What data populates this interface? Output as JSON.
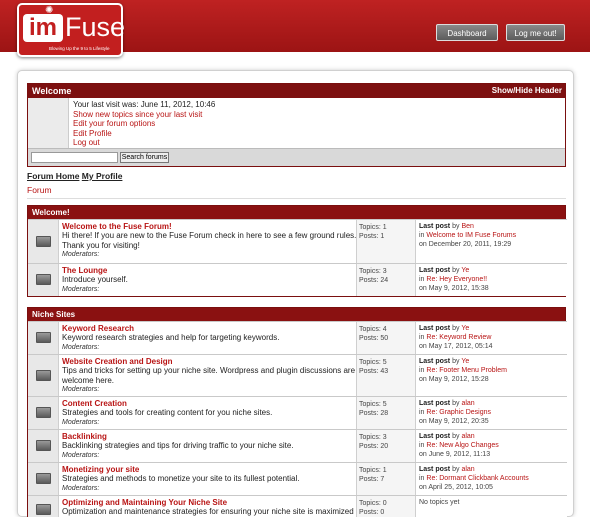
{
  "header": {
    "logo_im": "im",
    "logo_fuse": "Fuse",
    "logo_tagline": "Blowing Up the 9 to 5 Lifestyle",
    "dashboard_label": "Dashboard",
    "logout_label": "Log me out!"
  },
  "welcome": {
    "title": "Welcome",
    "toggle_label": "Show/Hide Header",
    "last_visit": "Your last visit was: June 11, 2012, 10:46",
    "links": [
      "Show new topics since your last visit",
      "Edit your forum options",
      "Edit Profile",
      "Log out"
    ],
    "search_button": "Search forums",
    "search_value": ""
  },
  "nav": {
    "tabs": [
      "Forum Home",
      "My Profile"
    ],
    "breadcrumb": "Forum"
  },
  "categories": [
    {
      "name": "Welcome!",
      "forums": [
        {
          "title": "Welcome to the Fuse Forum!",
          "desc": "Hi there! If you are new to the Fuse Forum check in here to see a few ground rules. Thank you for visiting!",
          "mods": "Moderators:",
          "topics": "Topics: 1",
          "posts": "Posts: 1",
          "last_label": "Last post",
          "by": "by",
          "user": "Ben",
          "in": "in",
          "thread": "Welcome to IM Fuse Forums",
          "date": "on December 20, 2011, 19:29"
        },
        {
          "title": "The Lounge",
          "desc": "Introduce yourself.",
          "mods": "Moderators:",
          "topics": "Topics: 3",
          "posts": "Posts: 24",
          "last_label": "Last post",
          "by": "by",
          "user": "Ye",
          "in": "in",
          "thread": "Re: Hey Everyone!!",
          "date": "on May 9, 2012, 15:38"
        }
      ]
    },
    {
      "name": "Niche Sites",
      "forums": [
        {
          "title": "Keyword Research",
          "desc": "Keyword research strategies and help for targeting keywords.",
          "mods": "Moderators:",
          "topics": "Topics: 4",
          "posts": "Posts: 50",
          "last_label": "Last post",
          "by": "by",
          "user": "Ye",
          "in": "in",
          "thread": "Re: Keyword Review",
          "date": "on May 17, 2012, 05:14"
        },
        {
          "title": "Website Creation and Design",
          "desc": "Tips and tricks for setting up your niche site. Wordpress and plugin discussions are welcome here.",
          "mods": "Moderators:",
          "topics": "Topics: 5",
          "posts": "Posts: 43",
          "last_label": "Last post",
          "by": "by",
          "user": "Ye",
          "in": "in",
          "thread": "Re: Footer Menu Problem",
          "date": "on May 9, 2012, 15:28"
        },
        {
          "title": "Content Creation",
          "desc": "Strategies and tools for creating content for you niche sites.",
          "mods": "Moderators:",
          "topics": "Topics: 5",
          "posts": "Posts: 28",
          "last_label": "Last post",
          "by": "by",
          "user": "alan",
          "in": "in",
          "thread": "Re: Graphic Designs",
          "date": "on May 9, 2012, 20:35"
        },
        {
          "title": "Backlinking",
          "desc": "Backlinking strategies and tips for driving traffic to your niche site.",
          "mods": "Moderators:",
          "topics": "Topics: 3",
          "posts": "Posts: 20",
          "last_label": "Last post",
          "by": "by",
          "user": "alan",
          "in": "in",
          "thread": "Re: New Algo Changes",
          "date": "on June 9, 2012, 11:13"
        },
        {
          "title": "Monetizing your site",
          "desc": "Strategies and methods to monetize your site to its fullest potential.",
          "mods": "Moderators:",
          "topics": "Topics: 1",
          "posts": "Posts: 7",
          "last_label": "Last post",
          "by": "by",
          "user": "alan",
          "in": "in",
          "thread": "Re: Dormant Clickbank Accounts",
          "date": "on April 25, 2012, 10:05"
        },
        {
          "title": "Optimizing and Maintaining Your Niche Site",
          "desc": "Optimization and maintenance strategies for ensuring your niche site is maximized",
          "mods": "",
          "topics": "Topics: 0",
          "posts": "Posts: 0",
          "no_topics": "No topics yet"
        }
      ]
    }
  ],
  "colors": {
    "brand_red": "#b31b1b",
    "header_dark_red": "#7d1010",
    "link_red": "#b81414"
  }
}
